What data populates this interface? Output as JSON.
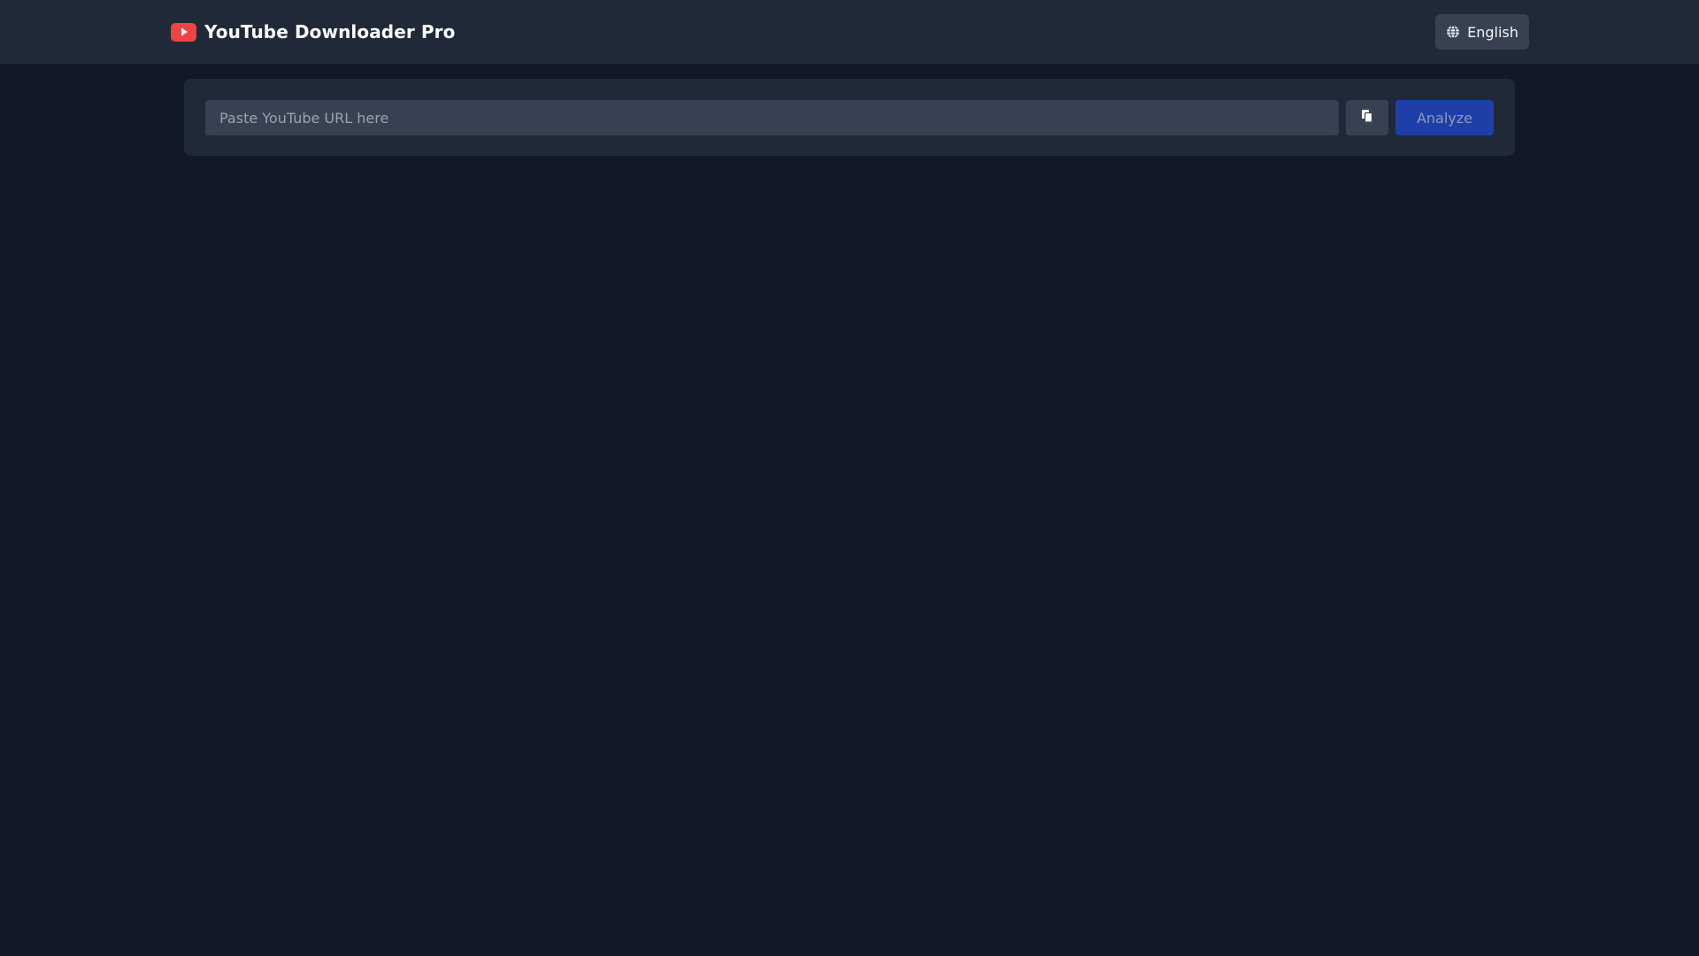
{
  "header": {
    "app_title": "YouTube Downloader Pro",
    "logo_icon": "youtube-play-icon",
    "language_label": "English",
    "language_icon": "globe-icon"
  },
  "search": {
    "placeholder": "Paste YouTube URL here",
    "value": "",
    "paste_icon": "clipboard-paste-icon",
    "analyze_label": "Analyze"
  },
  "colors": {
    "page_background": "#111827",
    "header_background": "#1f2937",
    "panel_background": "#1f2937",
    "input_background": "#374151",
    "brand_red": "#ef4444",
    "analyze_button": "#1e40af"
  }
}
